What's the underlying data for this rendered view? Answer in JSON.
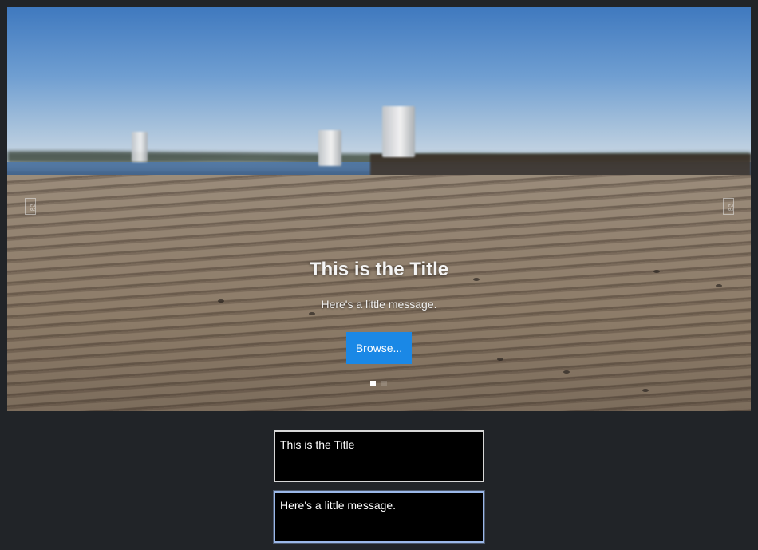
{
  "carousel": {
    "title": "This is the Title",
    "message": "Here's a little message.",
    "browse_label": "Browse...",
    "prev_glyph": "F3\n02",
    "next_glyph": "F3\n03",
    "indicator_count": 2,
    "active_index": 0,
    "background_image": "wooden-dock-photo"
  },
  "editor": {
    "title_value": "This is the Title",
    "message_value": "Here's a little message."
  },
  "colors": {
    "page_background": "#212428",
    "button": "#1a88e6",
    "text_field": "#000000",
    "focus_border": "#9bb8e9"
  }
}
